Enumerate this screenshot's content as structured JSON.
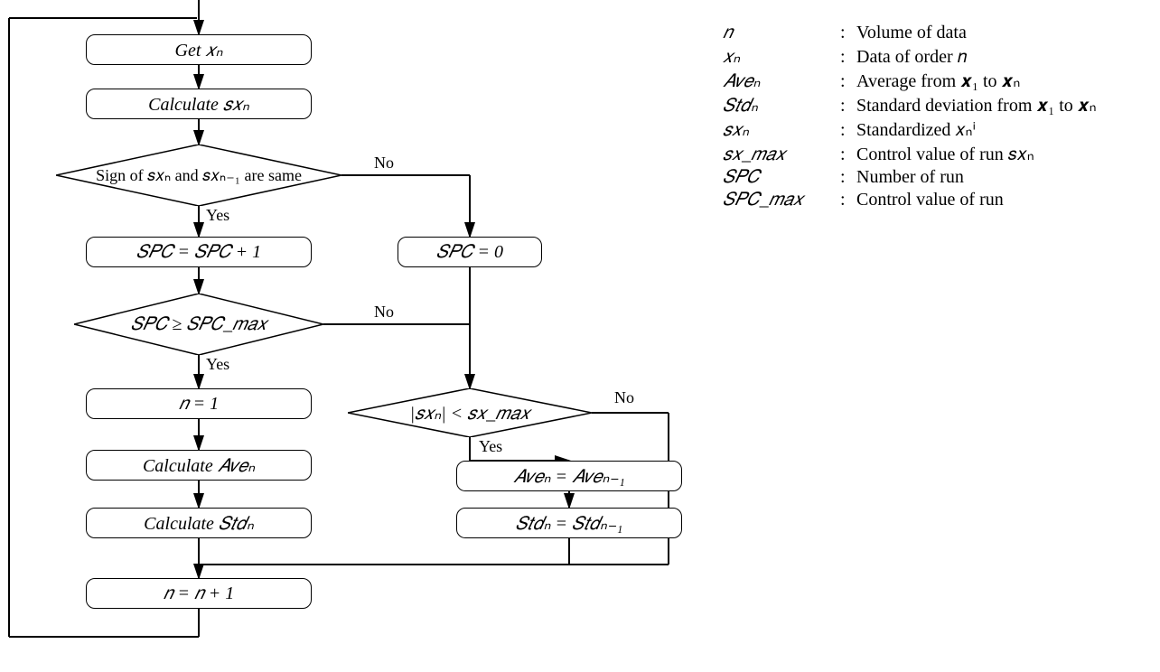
{
  "flow": {
    "b1": "Get 𝑥ₙ",
    "b2": "Calculate 𝑠𝑥ₙ",
    "d1": "Sign of 𝑠𝑥ₙ and 𝑠𝑥ₙ₋₁ are same",
    "b3": "𝑆𝑃𝐶 = 𝑆𝑃𝐶 + 1",
    "b3r": "𝑆𝑃𝐶 = 0",
    "d2": "𝑆𝑃𝐶 ≥ 𝑆𝑃𝐶_𝑚𝑎𝑥",
    "b4": "𝑛 = 1",
    "d3": "|𝑠𝑥ₙ| < 𝑠𝑥_𝑚𝑎𝑥",
    "b5": "Calculate  𝐴𝑣𝑒ₙ",
    "b5r": "𝐴𝑣𝑒ₙ = 𝐴𝑣𝑒ₙ₋₁",
    "b6": "Calculate 𝑆𝑡𝑑ₙ",
    "b6r": "𝑆𝑡𝑑ₙ = 𝑆𝑡𝑑ₙ₋₁",
    "b7": "𝑛 = 𝑛 + 1",
    "yes": "Yes",
    "no": "No"
  },
  "legend": [
    {
      "sym": "𝑛",
      "desc": "Volume of data"
    },
    {
      "sym": "𝑥ₙ",
      "desc": "Data of order 𝑛"
    },
    {
      "sym": "𝐴𝑣𝑒ₙ",
      "desc": "Average from 𝒙₁ to 𝒙ₙ"
    },
    {
      "sym": "𝑆𝑡𝑑ₙ",
      "desc": "Standard deviation from 𝒙₁ to 𝒙ₙ"
    },
    {
      "sym": "𝑠𝑥ₙ",
      "desc": "Standardized 𝑥ₙⁱ"
    },
    {
      "sym": "𝑠𝑥_𝑚𝑎𝑥",
      "desc": "Control value of run  𝑠𝑥ₙ"
    },
    {
      "sym": "𝑆𝑃𝐶",
      "desc": "Number of run"
    },
    {
      "sym": "𝑆𝑃𝐶_𝑚𝑎𝑥",
      "desc": "Control value of run"
    }
  ]
}
